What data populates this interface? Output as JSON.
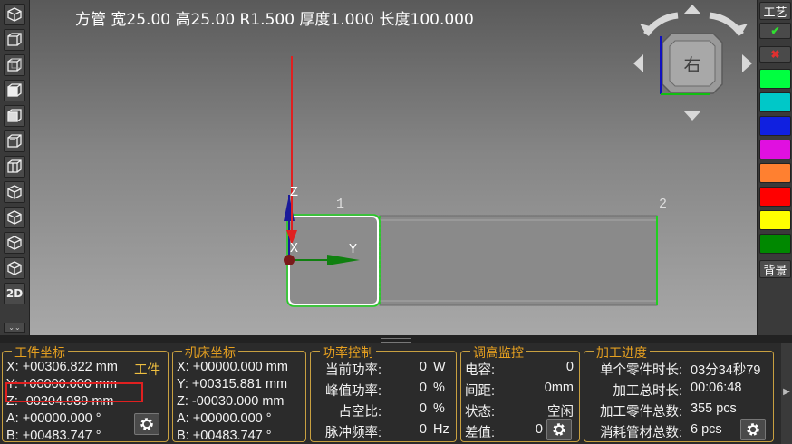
{
  "part_info": "方管 宽25.00 高25.00 R1.500 厚度1.000 长度100.000",
  "left_toolbar": {
    "btn_2d": "2D",
    "collapse": "⌄⌄"
  },
  "view_cube": {
    "face_label": "右"
  },
  "scene": {
    "axis_z": "Z",
    "axis_x": "X",
    "axis_y": "Y",
    "point_1": "1",
    "point_2": "2"
  },
  "right_toolbar": {
    "process_label": "工艺",
    "ok_glyph": "✔",
    "cancel_glyph": "✖",
    "colors": [
      "#00ff40",
      "#00c8c8",
      "#1020e0",
      "#e010e0",
      "#ff8030",
      "#ff0000",
      "#ffff00",
      "#008800"
    ],
    "background_label": "背景"
  },
  "workpiece_coords": {
    "title": "工件坐标",
    "x": "X: +00306.822 mm",
    "x_badge": "工件",
    "y": "Y: +00000.000 mm",
    "z": "Z: -00204.989 mm",
    "a": "A: +00000.000 °",
    "b": "B: +00483.747 °"
  },
  "machine_coords": {
    "title": "机床坐标",
    "x": "X: +00000.000 mm",
    "y": "Y: +00315.881 mm",
    "z": "Z: -00030.000 mm",
    "a": "A: +00000.000 °",
    "b": "B: +00483.747 °"
  },
  "power_control": {
    "title": "功率控制",
    "rows": [
      {
        "label": "当前功率:",
        "value": "0",
        "unit": "W"
      },
      {
        "label": "峰值功率:",
        "value": "0",
        "unit": "%"
      },
      {
        "label": "占空比:",
        "value": "0",
        "unit": "%"
      },
      {
        "label": "脉冲频率:",
        "value": "0",
        "unit": "Hz"
      }
    ]
  },
  "height_monitor": {
    "title": "调高监控",
    "rows": [
      {
        "label": "电容:",
        "value": "0"
      },
      {
        "label": "间距:",
        "value": "0mm"
      },
      {
        "label": "状态:",
        "value": "空闲"
      },
      {
        "label": "差值:",
        "value": "0"
      }
    ]
  },
  "progress": {
    "title": "加工进度",
    "rows": [
      {
        "label": "单个零件时长:",
        "value": "03分34秒79"
      },
      {
        "label": "加工总时长:",
        "value": "00:06:48"
      },
      {
        "label": "加工零件总数:",
        "value": "355 pcs"
      },
      {
        "label": "消耗管材总数:",
        "value": "6 pcs"
      }
    ]
  }
}
